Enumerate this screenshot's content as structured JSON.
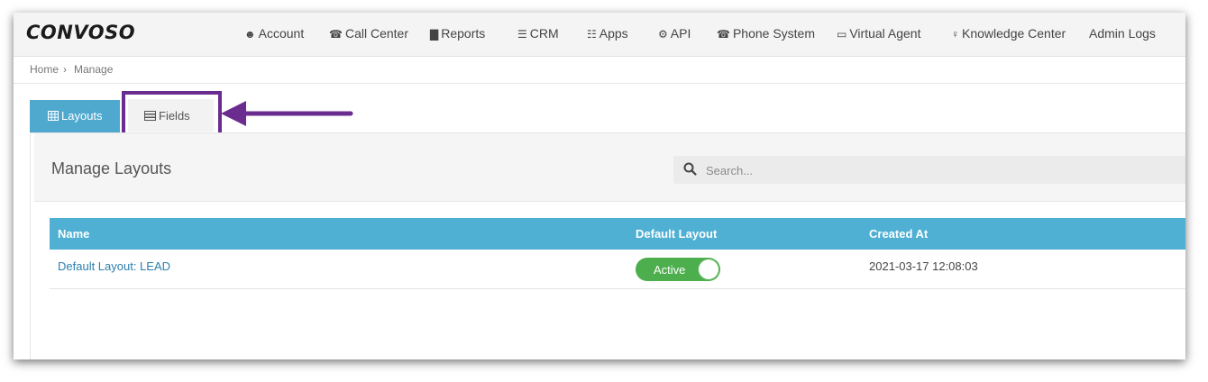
{
  "app": {
    "logo": "CONVOSO"
  },
  "nav": {
    "items": [
      {
        "label": "Account",
        "icon": "user-icon",
        "glyph": "☻"
      },
      {
        "label": "Call Center",
        "icon": "phone-icon",
        "glyph": "☎"
      },
      {
        "label": "Reports",
        "icon": "bar-chart-icon",
        "glyph": "▇"
      },
      {
        "label": "CRM",
        "icon": "list-icon",
        "glyph": "☰"
      },
      {
        "label": "Apps",
        "icon": "grid-icon",
        "glyph": "☷"
      },
      {
        "label": "API",
        "icon": "gear-icon",
        "glyph": "⚙"
      },
      {
        "label": "Phone System",
        "icon": "phone-icon",
        "glyph": "☎"
      },
      {
        "label": "Virtual Agent",
        "icon": "monitor-icon",
        "glyph": "▭"
      },
      {
        "label": "Knowledge Center",
        "icon": "lightbulb-icon",
        "glyph": "♀"
      },
      {
        "label": "Admin Logs",
        "icon": "",
        "glyph": ""
      }
    ]
  },
  "breadcrumb": {
    "home": "Home",
    "separator": "›",
    "current": "Manage"
  },
  "tabs": {
    "layouts": {
      "label": "Layouts",
      "icon": "table-icon"
    },
    "fields": {
      "label": "Fields",
      "icon": "server-icon"
    }
  },
  "panel": {
    "title": "Manage Layouts",
    "search_placeholder": "Search..."
  },
  "table": {
    "columns": [
      "Name",
      "Default Layout",
      "Created At"
    ],
    "rows": [
      {
        "name": "Default Layout: LEAD",
        "default_status": "Active",
        "created_at": "2021-03-17 12:08:03"
      }
    ]
  },
  "colors": {
    "tab_active": "#4fa9cf",
    "table_header": "#4fb0d3",
    "toggle_on": "#4cae4c",
    "link": "#2c7fae",
    "annotation": "#6b2c8f"
  }
}
